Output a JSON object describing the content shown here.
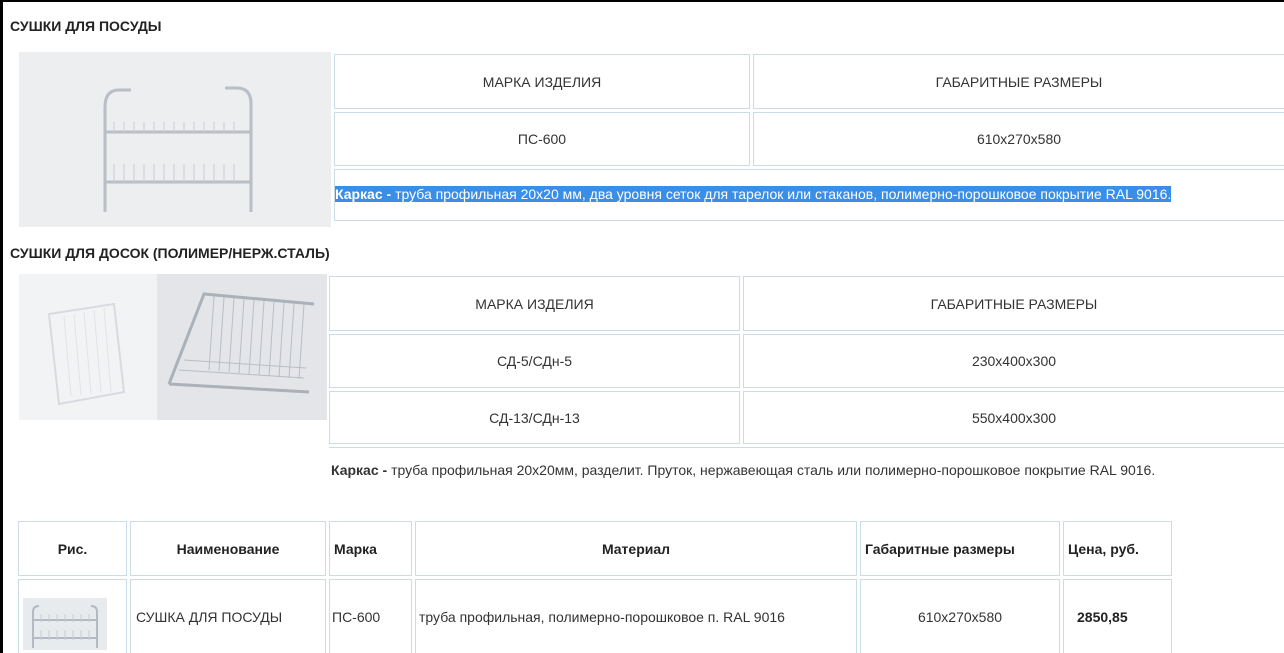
{
  "section1": {
    "title": "СУШКИ ДЛЯ ПОСУДЫ",
    "col_model": "МАРКА ИЗДЕЛИЯ",
    "col_dims": "ГАБАРИТНЫЕ РАЗМЕРЫ",
    "rows": [
      {
        "model": "ПС-600",
        "dims": "610x270x580"
      }
    ],
    "desc_bold": "Каркас -",
    "desc_text": " труба профильная 20x20 мм, два уровня сеток для тарелок или стаканов, полимерно-порошковое покрытие RAL 9016.",
    "image_icon": "dish-dryer-photo"
  },
  "section2": {
    "title": "СУШКИ ДЛЯ ДОСОК (ПОЛИМЕР/НЕРЖ.СТАЛЬ)",
    "col_model": "МАРКА ИЗДЕЛИЯ",
    "col_dims": "ГАБАРИТНЫЕ РАЗМЕРЫ",
    "rows": [
      {
        "model": "СД-5/СДн-5",
        "dims": "230x400x300"
      },
      {
        "model": "СД-13/СДн-13",
        "dims": "550x400x300"
      }
    ],
    "desc_bold": "Каркас -",
    "desc_text": " труба профильная 20x20мм, разделит. Пруток, нержавеющая сталь или полимерно-порошковое покрытие RAL 9016.",
    "image_icon": "board-dryer-photo"
  },
  "price_table": {
    "headers": {
      "pic": "Рис.",
      "name": "Наименование",
      "model": "Марка",
      "material": "Материал",
      "dims": "Габаритные размеры",
      "price": "Цена, руб."
    },
    "rows": [
      {
        "name": "СУШКА ДЛЯ ПОСУДЫ",
        "model": "ПС-600",
        "material": "труба профильная, полимерно-порошковое п. RAL 9016",
        "dims": "610x270x580",
        "price": "2850,85"
      }
    ]
  },
  "colors": {
    "border": "#c9dce8",
    "selection": "#3a8ee6",
    "text": "#333333"
  }
}
